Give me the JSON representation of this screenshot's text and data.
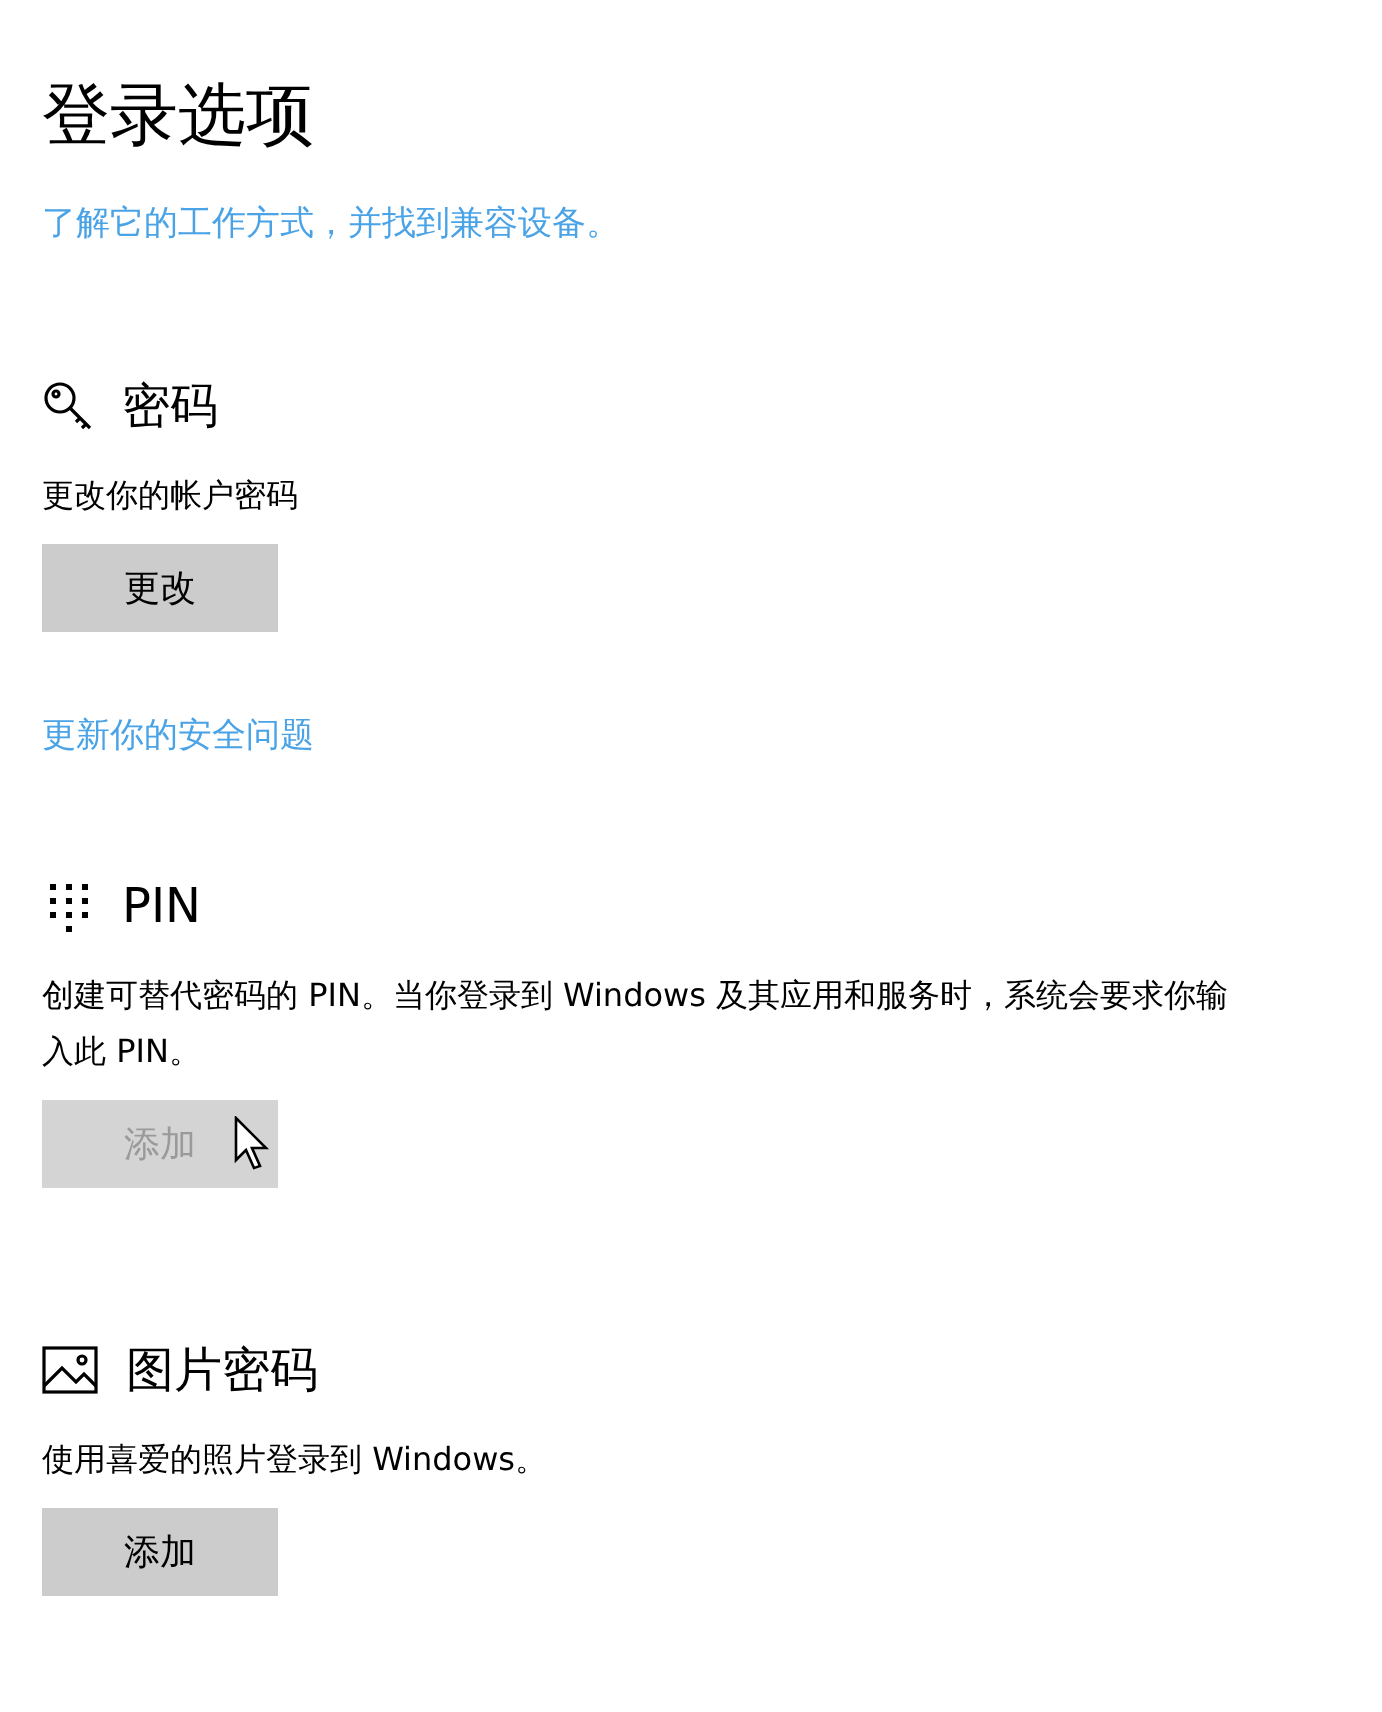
{
  "title": "登录选项",
  "intro_link": "了解它的工作方式，并找到兼容设备。",
  "sections": [
    {
      "kind": "key",
      "heading": "密码",
      "description": "更改你的帐户密码",
      "button": {
        "label": "更改",
        "disabled": false
      },
      "link": "更新你的安全问题"
    },
    {
      "kind": "keypad",
      "heading": "PIN",
      "description": "创建可替代密码的 PIN。当你登录到 Windows 及其应用和服务时，系统会要求你输入此 PIN。",
      "button": {
        "label": "添加",
        "disabled": true
      }
    },
    {
      "kind": "image",
      "heading": "图片密码",
      "description": "使用喜爱的照片登录到 Windows。",
      "button": {
        "label": "添加",
        "disabled": false
      }
    }
  ]
}
